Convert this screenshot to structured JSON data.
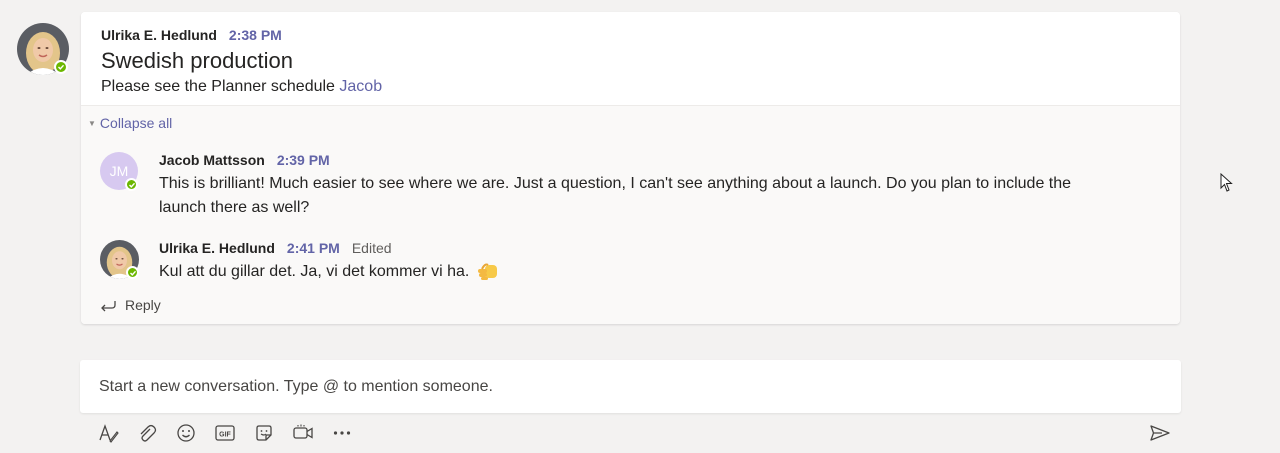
{
  "post": {
    "author": "Ulrika E. Hedlund",
    "time": "2:38 PM",
    "subject": "Swedish production",
    "body_text": "Please see the Planner schedule ",
    "mention": "Jacob"
  },
  "thread": {
    "collapse_label": "Collapse all",
    "replies": [
      {
        "initials": "JM",
        "author": "Jacob Mattsson",
        "time": "2:39 PM",
        "text_line1": "This is brilliant! Much easier to see where we are. Just a question, I can't see anything about a launch. Do you plan to include the",
        "text_line2": "launch there as well?"
      },
      {
        "author": "Ulrika E. Hedlund",
        "time": "2:41 PM",
        "edited": "Edited",
        "text": "Kul att du gillar det. Ja, vi det kommer vi ha. "
      }
    ],
    "reply_label": "Reply"
  },
  "compose": {
    "placeholder": "Start a new conversation. Type @ to mention someone."
  },
  "toolbar": {
    "icons": [
      "format-icon",
      "attach-icon",
      "emoji-icon",
      "gif-icon",
      "sticker-icon",
      "meet-now-icon",
      "more-options-icon",
      "send-icon"
    ]
  },
  "colors": {
    "accent": "#6264a7",
    "presence_available": "#6bb700",
    "background": "#f3f2f1"
  }
}
